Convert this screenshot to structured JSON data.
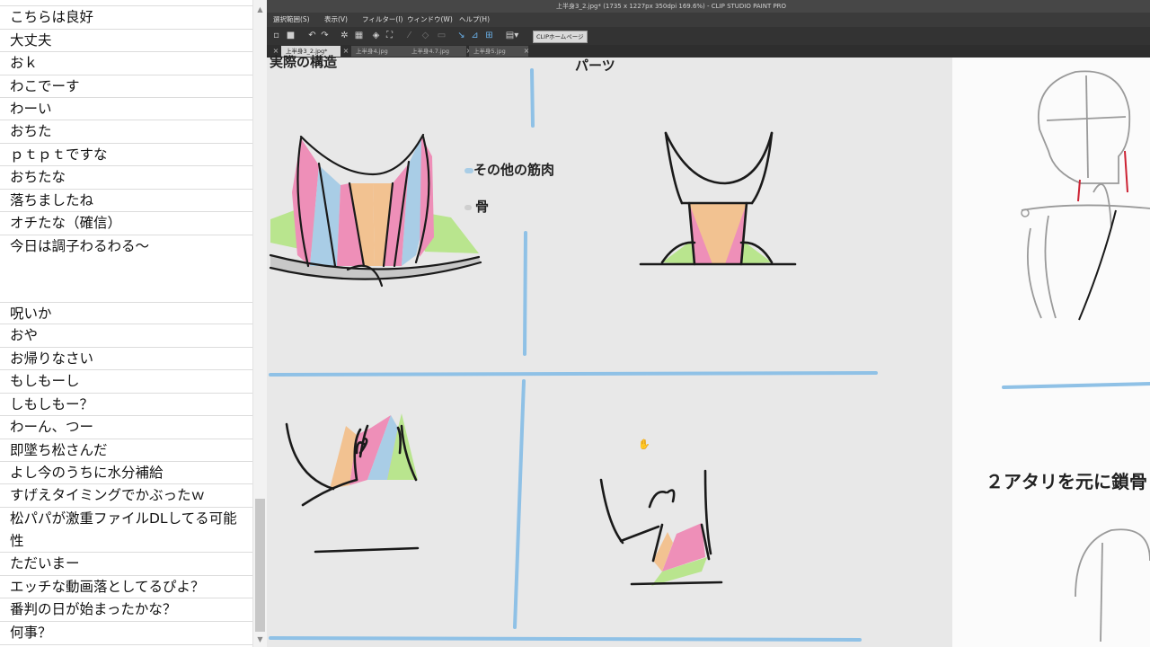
{
  "comments": [
    "こちらは良好",
    "大丈夫",
    "おｋ",
    "わこでーす",
    "わーい",
    "おちた",
    "ｐｔｐｔですな",
    "おちたな",
    "落ちましたね",
    "オチたな（確信）",
    "今日は調子わるわる～",
    "",
    "呪いか",
    "おや",
    "お帰りなさい",
    "もしもーし",
    "しもしもー？",
    "わーん、つー",
    "即墜ち松さんだ",
    "よし今のうちに水分補給",
    "すげえタイミングでかぶったｗ",
    "松パパが激重ファイルDLしてる可能性",
    "ただいまー",
    "エッチな動画落としてるぴよ？",
    "番判の日が始まったかな？",
    "何事？"
  ],
  "app": {
    "title": "上半身3_2.jpg* (1735 x 1227px 350dpi 169.6%)  - CLIP STUDIO PAINT PRO",
    "menu": [
      "選択範囲(S)",
      "表示(V)",
      "フィルター(I)",
      "ウィンドウ(W)",
      "ヘルプ(H)"
    ],
    "homepage_button": "CLIPホームページ",
    "tabs": [
      "上半身3_2.jpg*",
      "上半身4.jpg",
      "上半身4.7.jpg",
      "上半身5.jpg"
    ]
  },
  "canvas": {
    "label_structure": "実際の構造",
    "label_parts": "パーツ",
    "legend_muscle": "その他の筋肉",
    "legend_bone": "骨",
    "caption_right": "２アタリを元に鎖骨"
  },
  "colors": {
    "pink": "#ee8fb8",
    "blue": "#a9cde6",
    "orange": "#f2c291",
    "green": "#b9e58e",
    "guide_blue": "#8fc1e6",
    "red_line": "#cc2233"
  }
}
